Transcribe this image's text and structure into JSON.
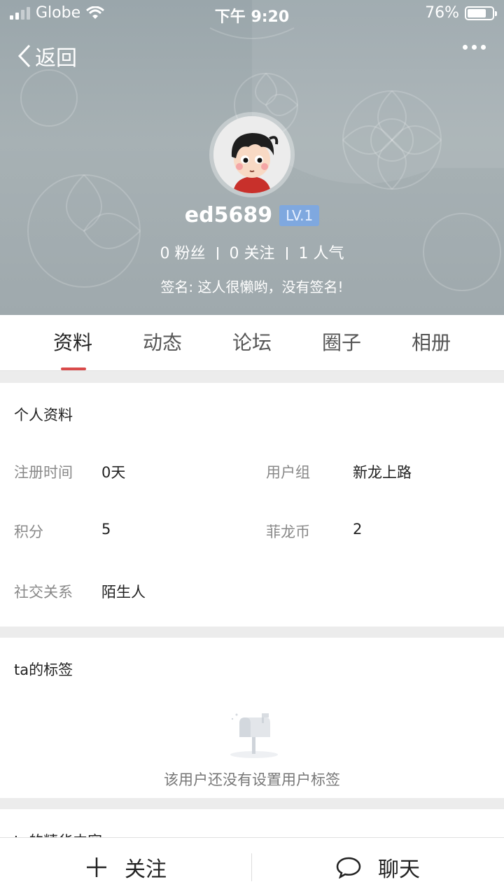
{
  "status_bar": {
    "carrier": "Globe",
    "time": "下午 9:20",
    "battery_percent": "76%",
    "battery_level": 0.76
  },
  "nav": {
    "back_label": "返回"
  },
  "profile": {
    "username": "ed5689",
    "level": "LV.1",
    "fans": "0 粉丝",
    "following": "0 关注",
    "popularity": "1 人气",
    "signature": "签名: 这人很懒哟，没有签名!"
  },
  "tabs": [
    {
      "label": "资料",
      "active": true
    },
    {
      "label": "动态",
      "active": false
    },
    {
      "label": "论坛",
      "active": false
    },
    {
      "label": "圈子",
      "active": false
    },
    {
      "label": "相册",
      "active": false
    }
  ],
  "personal_info": {
    "title": "个人资料",
    "register_time_label": "注册时间",
    "register_time_value": "0天",
    "user_group_label": "用户组",
    "user_group_value": "新龙上路",
    "points_label": "积分",
    "points_value": "5",
    "coins_label": "菲龙币",
    "coins_value": "2",
    "relation_label": "社交关系",
    "relation_value": "陌生人"
  },
  "tags": {
    "title": "ta的标签",
    "empty_text": "该用户还没有设置用户标签"
  },
  "featured": {
    "title": "ta的精华内容"
  },
  "bottom_bar": {
    "follow_label": "关注",
    "chat_label": "聊天"
  },
  "colors": {
    "accent": "#d94a4a",
    "level_badge": "#7fa8df"
  }
}
